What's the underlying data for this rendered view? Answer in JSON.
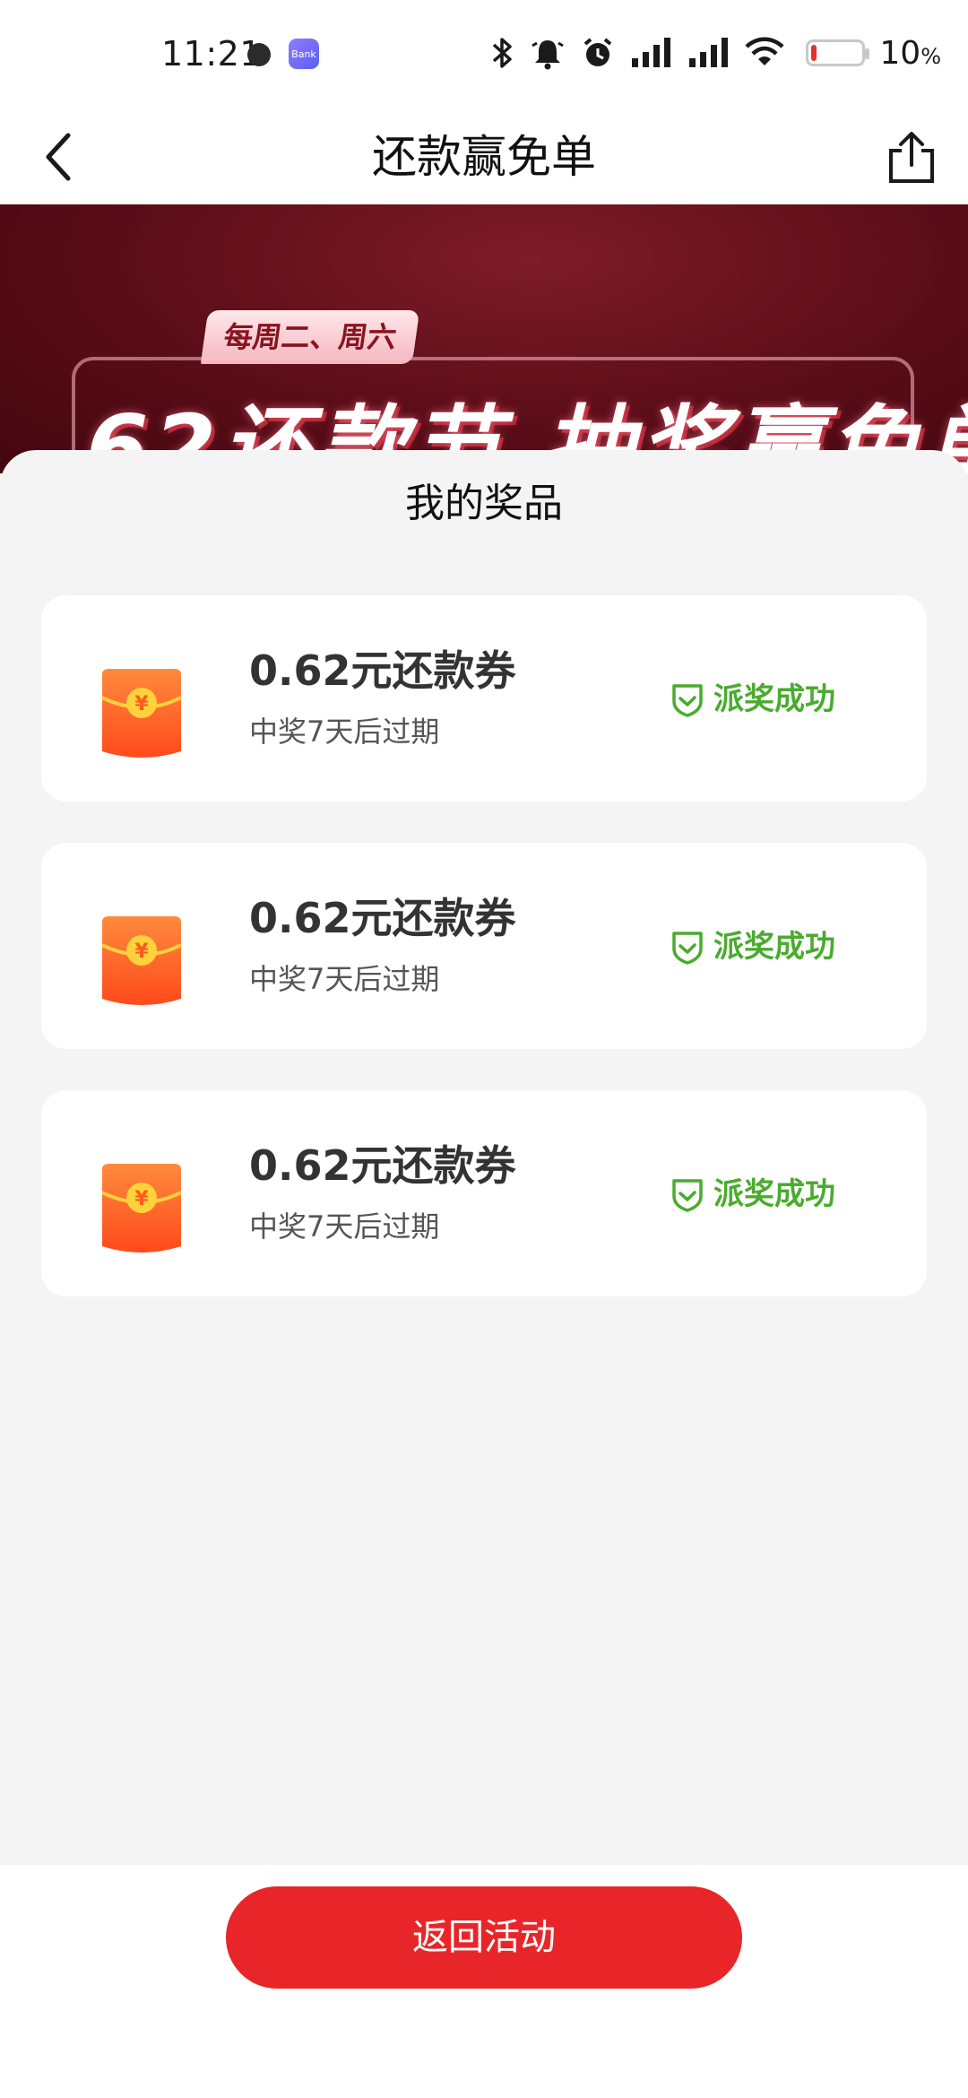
{
  "status_bar": {
    "time": "11:21",
    "app_icon_text": "Bank",
    "battery_text": "10",
    "battery_unit": "%",
    "battery_level_percent": 10
  },
  "header": {
    "title": "还款赢免单"
  },
  "banner": {
    "tag": "每周二、周六",
    "headline": "62还款节 抽奖赢免单"
  },
  "sheet": {
    "title": "我的奖品",
    "prizes": [
      {
        "name": "0.62元还款券",
        "expiry": "中奖7天后过期",
        "status": "派奖成功"
      },
      {
        "name": "0.62元还款券",
        "expiry": "中奖7天后过期",
        "status": "派奖成功"
      },
      {
        "name": "0.62元还款券",
        "expiry": "中奖7天后过期",
        "status": "派奖成功"
      }
    ]
  },
  "footer": {
    "return_label": "返回活动"
  },
  "colors": {
    "accent_red": "#e8262a",
    "success_green": "#4aab2e",
    "banner_dark": "#5a0d18"
  },
  "icons": {
    "back": "chevron-left-icon",
    "share": "share-icon",
    "prize": "red-packet-icon",
    "status": "shield-check-icon"
  }
}
